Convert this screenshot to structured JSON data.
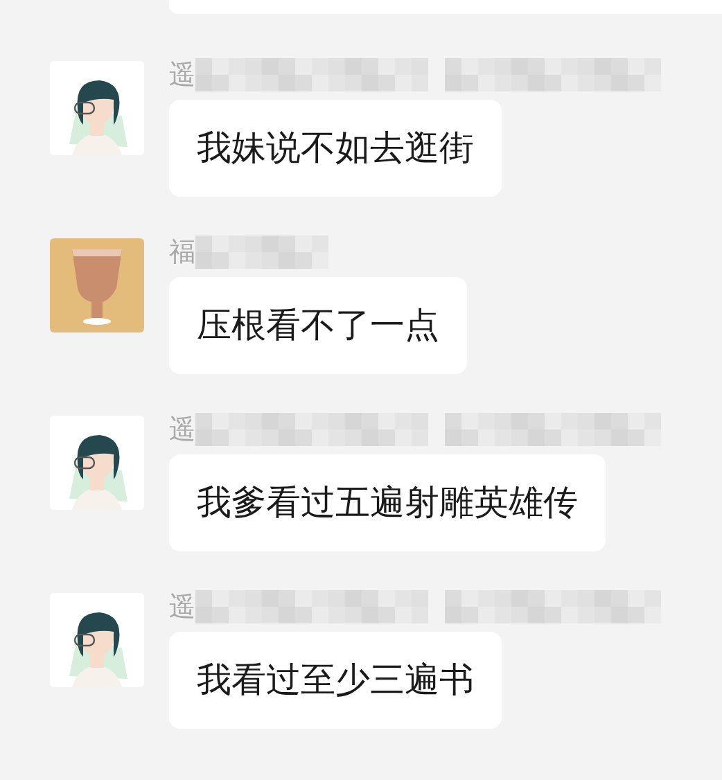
{
  "messages": [
    {
      "sender": "遥",
      "kind": "person",
      "text": "我妹说不如去逛街"
    },
    {
      "sender": "福",
      "kind": "cup",
      "text": "压根看不了一点"
    },
    {
      "sender": "遥",
      "kind": "person",
      "text": "我爹看过五遍射雕英雄传"
    },
    {
      "sender": "遥",
      "kind": "person",
      "text": "我看过至少三遍书"
    }
  ]
}
